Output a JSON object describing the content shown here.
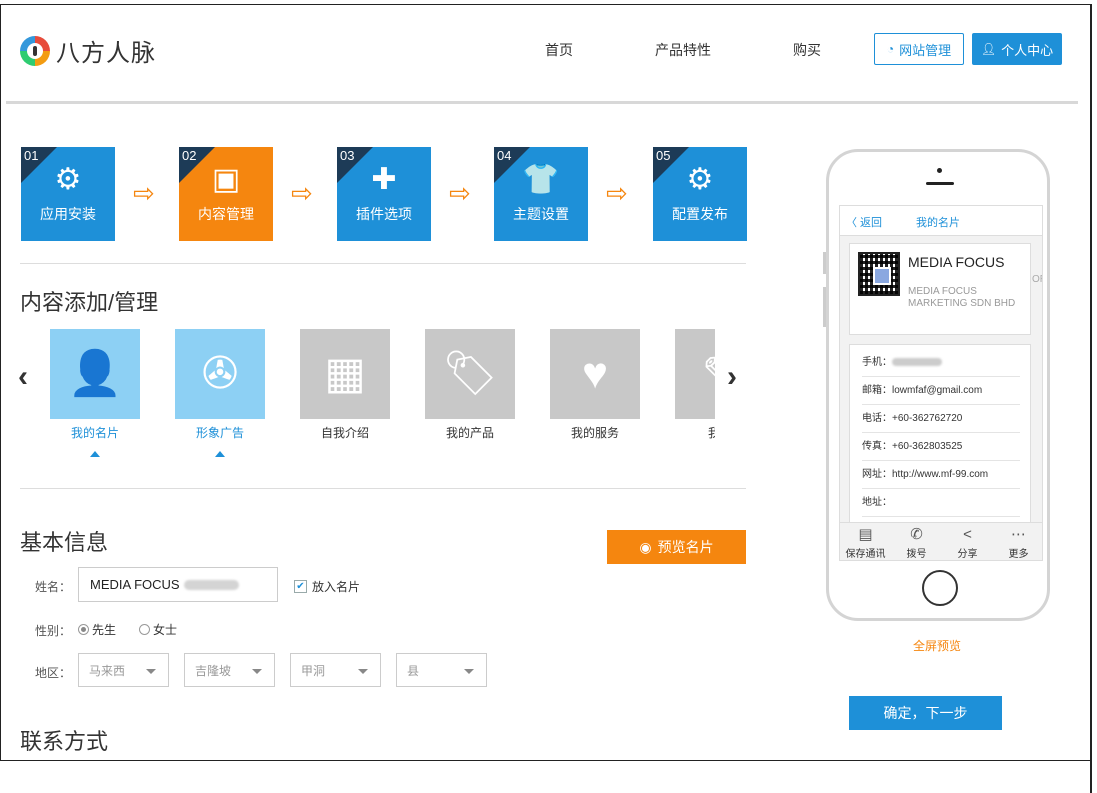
{
  "header": {
    "logo_text": "八方人脉",
    "nav": [
      {
        "label": "首页"
      },
      {
        "label": "产品特性"
      },
      {
        "label": "购买"
      }
    ],
    "site_manage": "网站管理",
    "user_center": "个人中心"
  },
  "steps": [
    {
      "num": "01",
      "label": "应用安装",
      "icon": "gear-icon",
      "glyph": "⚙",
      "state": "done"
    },
    {
      "num": "02",
      "label": "内容管理",
      "icon": "floppy-icon",
      "glyph": "▣",
      "state": "active"
    },
    {
      "num": "03",
      "label": "插件选项",
      "icon": "puzzle-icon",
      "glyph": "✚",
      "state": "todo"
    },
    {
      "num": "04",
      "label": "主题设置",
      "icon": "shirt-icon",
      "glyph": "👕",
      "state": "todo"
    },
    {
      "num": "05",
      "label": "配置发布",
      "icon": "gears-icon",
      "glyph": "⚙",
      "state": "todo"
    }
  ],
  "step_arrow": "⇨",
  "content_section": {
    "title": "内容添加/管理",
    "prev": "‹",
    "next": "›",
    "tiles": [
      {
        "label": "我的名片",
        "icon": "contact-card-icon",
        "glyph": "👤",
        "active": true
      },
      {
        "label": "形象广告",
        "icon": "film-reel-icon",
        "glyph": "✇",
        "active": true
      },
      {
        "label": "自我介绍",
        "icon": "building-icon",
        "glyph": "▦",
        "active": false
      },
      {
        "label": "我的产品",
        "icon": "tag-icon",
        "glyph": "🏷",
        "active": false
      },
      {
        "label": "我的服务",
        "icon": "heart-icon",
        "glyph": "♥",
        "active": false
      },
      {
        "label": "我的",
        "icon": "pen-icon",
        "glyph": "✎",
        "active": false
      }
    ]
  },
  "basic_info": {
    "title": "基本信息",
    "preview_button": "预览名片",
    "name_label": "姓名：",
    "name_value": "MEDIA FOCUS",
    "put_in_card": "放入名片",
    "gender_label": "性别：",
    "gender_options": [
      "先生",
      "女士"
    ],
    "gender_selected": "先生",
    "region_label": "地区：",
    "region_selects": [
      "马来西",
      "吉隆坡",
      "甲洞",
      "县"
    ]
  },
  "contact_title": "联系方式",
  "phone_preview": {
    "back": "〈 返回",
    "title": "我的名片",
    "card_name": "MEDIA FOCUS",
    "card_company": "MEDIA FOCUS MARKETING SDN BHD",
    "card_overflow": "OR",
    "rows": [
      {
        "label": "手机：",
        "value": ""
      },
      {
        "label": "邮箱：",
        "value": "lowmfaf@gmail.com"
      },
      {
        "label": "电话：",
        "value": "+60-362762720"
      },
      {
        "label": "传真：",
        "value": "+60-362803525"
      },
      {
        "label": "网址：",
        "value": "http://www.mf-99.com"
      },
      {
        "label": "地址：",
        "value": ""
      }
    ],
    "tabs": [
      {
        "label": "保存通讯",
        "icon": "contacts-icon",
        "glyph": "▤"
      },
      {
        "label": "拨号",
        "icon": "phone-icon",
        "glyph": "✆"
      },
      {
        "label": "分享",
        "icon": "share-icon",
        "glyph": "<"
      },
      {
        "label": "更多",
        "icon": "more-icon",
        "glyph": "⋯"
      }
    ]
  },
  "fullscreen_preview": "全屏预览",
  "next_button": "确定，下一步",
  "colors": {
    "blue": "#1e90d8",
    "orange": "#f5860f",
    "dark_corner": "#1d3b57"
  }
}
